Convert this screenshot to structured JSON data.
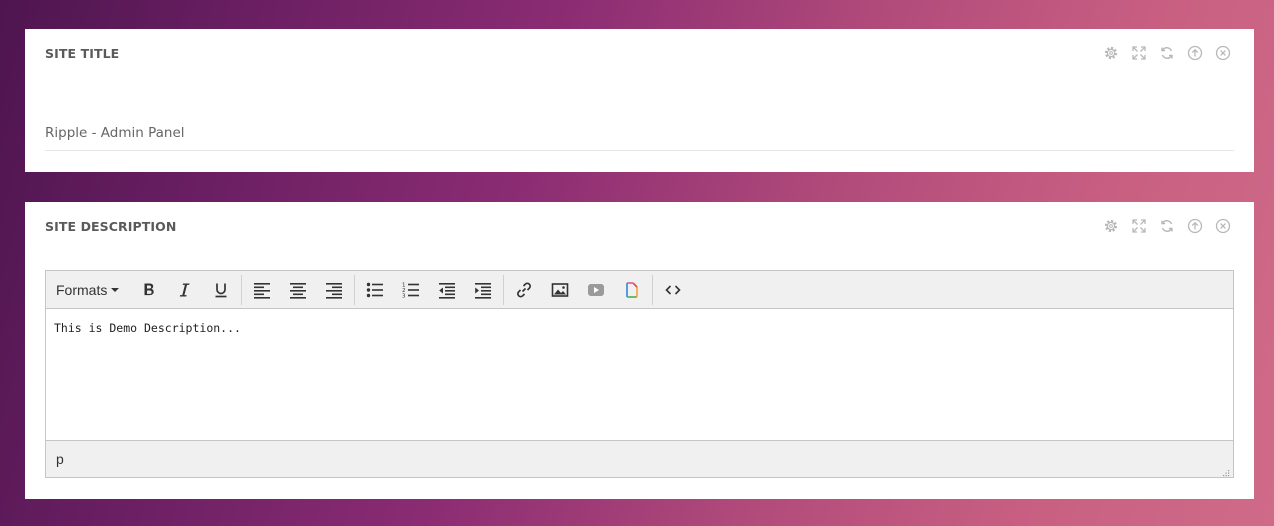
{
  "site_title_panel": {
    "title": "SITE TITLE",
    "value": "Ripple - Admin Panel",
    "tools": [
      "gear-icon",
      "expand-icon",
      "refresh-icon",
      "collapse-icon",
      "close-icon"
    ]
  },
  "site_description_panel": {
    "title": "SITE DESCRIPTION",
    "tools": [
      "gear-icon",
      "expand-icon",
      "refresh-icon",
      "collapse-icon",
      "close-icon"
    ],
    "editor": {
      "formats_label": "Formats",
      "toolbar_icons": [
        "bold-icon",
        "italic-icon",
        "underline-icon",
        "align-left-icon",
        "align-center-icon",
        "align-right-icon",
        "bullet-list-icon",
        "numbered-list-icon",
        "outdent-icon",
        "indent-icon",
        "link-icon",
        "image-icon",
        "video-icon",
        "file-icon",
        "code-icon"
      ],
      "content": "This is Demo Description...",
      "status_path": "p"
    }
  },
  "colors": {
    "background_start": "#4e1550",
    "background_end": "#cf6b88",
    "panel": "#ffffff",
    "tool_icon": "#b5b5b5",
    "toolbar_bg": "#f0f0f0"
  }
}
